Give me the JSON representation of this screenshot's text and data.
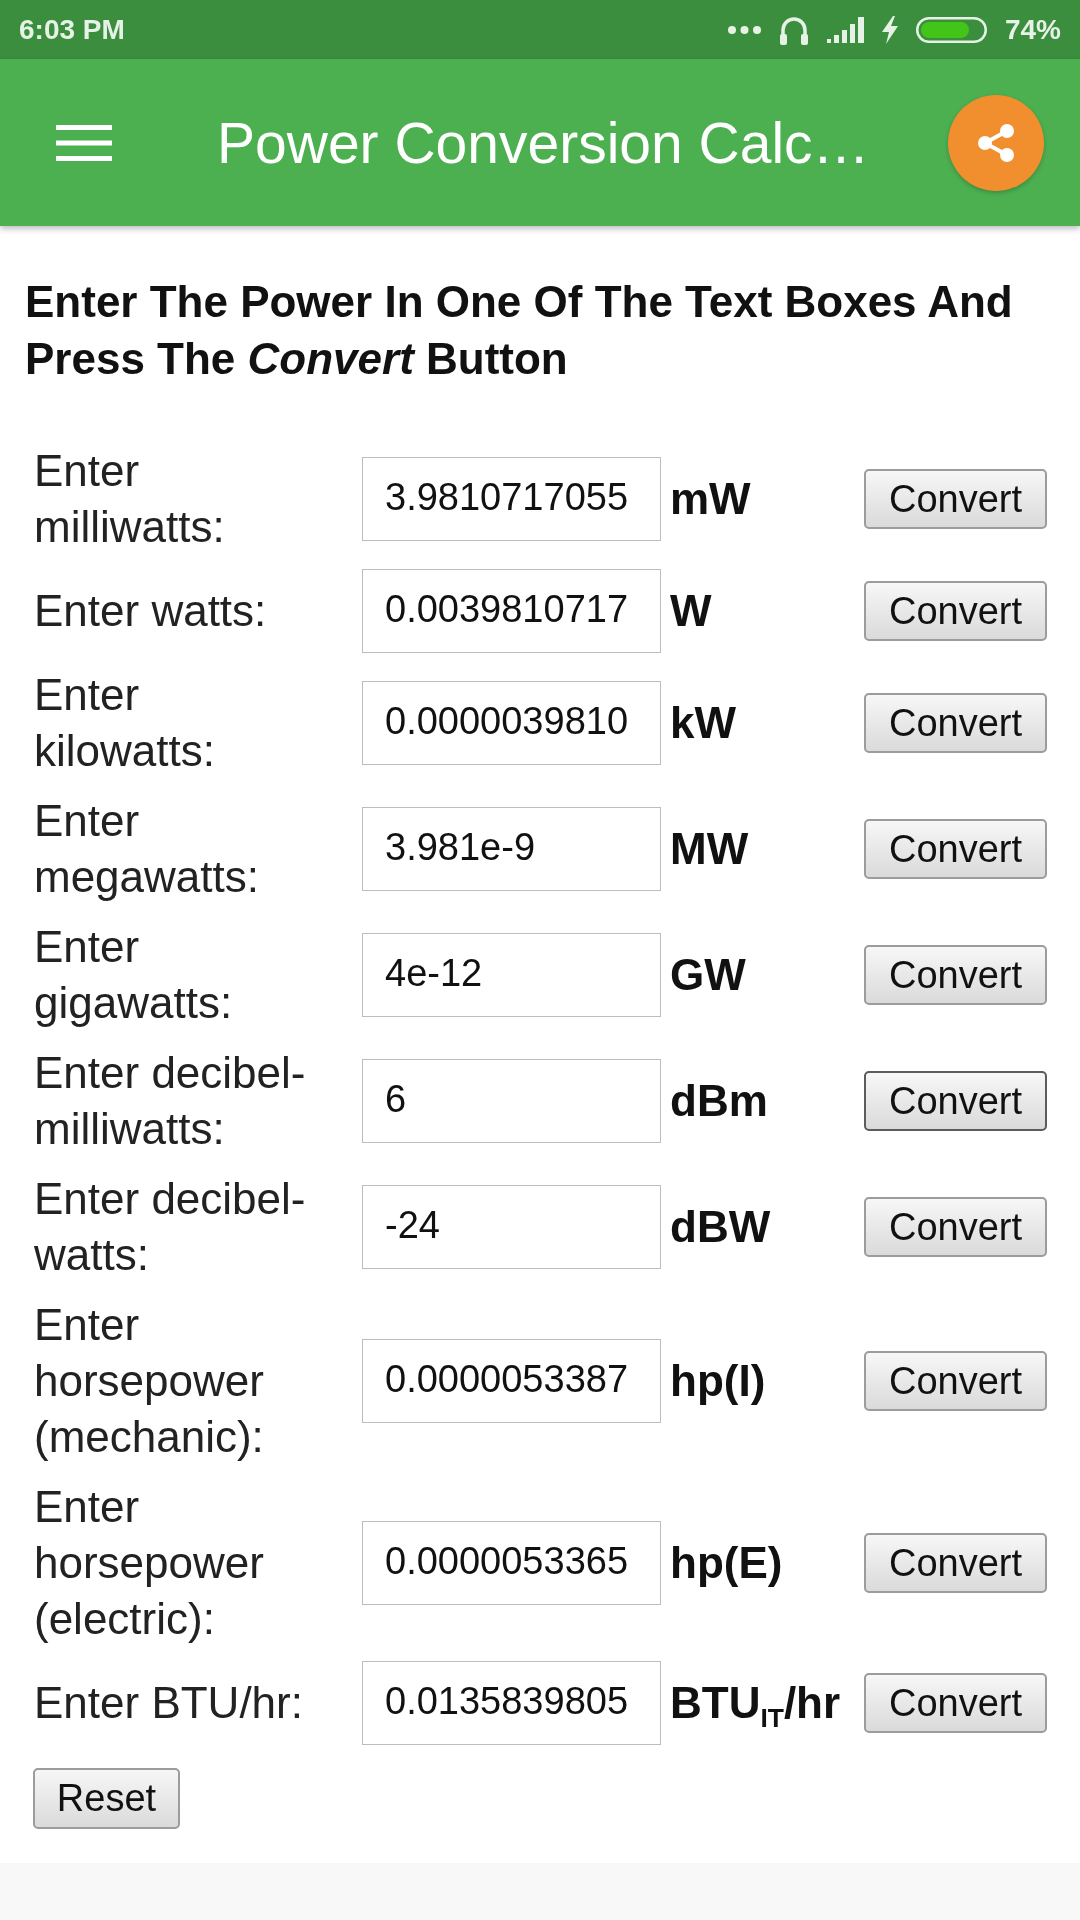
{
  "status_bar": {
    "time": "6:03 PM",
    "battery": "74%"
  },
  "app_bar": {
    "title": "Power Conversion Calc…"
  },
  "instructions": "Enter The Power In One Of The Text Boxes And Press The *Convert* Button",
  "rows": [
    {
      "label": "Enter milliwatts:",
      "value": "3.9810717055",
      "unit": "mW",
      "button": "Convert",
      "focused": false
    },
    {
      "label": "Enter watts:",
      "value": "0.0039810717",
      "unit": "W",
      "button": "Convert",
      "focused": false
    },
    {
      "label": "Enter kilowatts:",
      "value": "0.0000039810",
      "unit": "kW",
      "button": "Convert",
      "focused": false
    },
    {
      "label": "Enter megawatts:",
      "value": "3.981e-9",
      "unit": "MW",
      "button": "Convert",
      "focused": false
    },
    {
      "label": "Enter gigawatts:",
      "value": "4e-12",
      "unit": "GW",
      "button": "Convert",
      "focused": false
    },
    {
      "label": "Enter decibel-milliwatts:",
      "value": "6",
      "unit": "dBm",
      "button": "Convert",
      "focused": true
    },
    {
      "label": "Enter decibel-watts:",
      "value": "-24",
      "unit": "dBW",
      "button": "Convert",
      "focused": false
    },
    {
      "label": "Enter horsepower (mechanic):",
      "value": "0.0000053387",
      "unit": "hp(I)",
      "button": "Convert",
      "focused": false
    },
    {
      "label": "Enter horsepower (electric):",
      "value": "0.0000053365",
      "unit": "hp(E)",
      "button": "Convert",
      "focused": false
    },
    {
      "label": "Enter BTU/hr:",
      "value": "0.0135839805",
      "unit": "BTU$_{IT}$/hr",
      "button": "Convert",
      "focused": false
    }
  ],
  "reset_button": "Reset"
}
